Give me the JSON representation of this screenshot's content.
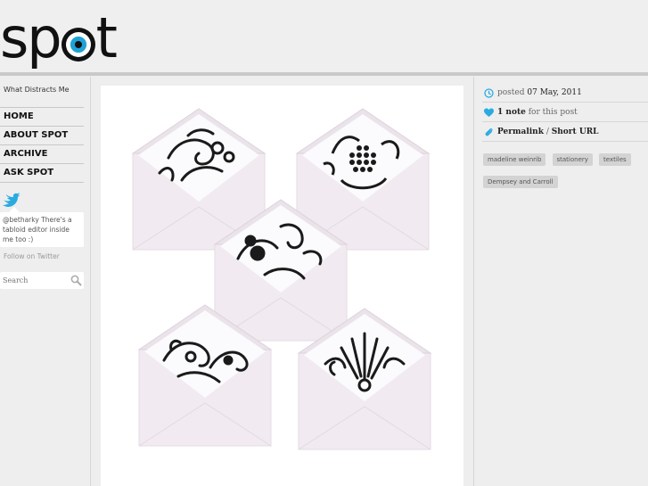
{
  "header": {
    "logo_text_left": "sp",
    "logo_text_right": "t",
    "logo_name": "spot-logo"
  },
  "sidebar": {
    "tagline": "What Distracts Me",
    "nav": [
      {
        "label": "HOME"
      },
      {
        "label": "ABOUT SPOT"
      },
      {
        "label": "ARCHIVE"
      },
      {
        "label": "ASK SPOT"
      }
    ],
    "tweet": "@betharky There's a tabloid editor inside me too :)",
    "follow_label": "Follow on Twitter",
    "search": {
      "placeholder": "Search",
      "value": "Search"
    }
  },
  "post": {
    "image_description": "envelopes-with-patterned-liners",
    "posted_prefix": "posted",
    "posted_date": "07 May, 2011",
    "notes_count": "1 note",
    "notes_suffix": "for this post",
    "permalink_label": "Permalink",
    "separator": "/",
    "short_url_label": "Short URL",
    "tags": [
      "madeline weinrib",
      "stationery",
      "textiles",
      "Dempsey and Carroll"
    ]
  },
  "colors": {
    "background": "#eeeeee",
    "accent_blue": "#1fa3d6",
    "heart_blue": "#29abe2",
    "tag_bg": "#d3d3d3",
    "envelope": "#efe8ee"
  }
}
